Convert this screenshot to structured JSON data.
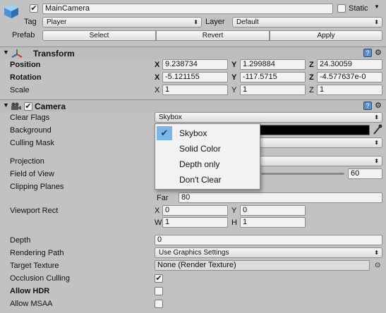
{
  "header": {
    "object_name": "MainCamera",
    "active_checked": true,
    "static_label": "Static",
    "tag_label": "Tag",
    "tag_value": "Player",
    "layer_label": "Layer",
    "layer_value": "Default",
    "prefab_label": "Prefab",
    "select_label": "Select",
    "revert_label": "Revert",
    "apply_label": "Apply"
  },
  "transform": {
    "title": "Transform",
    "position_label": "Position",
    "rotation_label": "Rotation",
    "scale_label": "Scale",
    "axis_x": "X",
    "axis_y": "Y",
    "axis_z": "Z",
    "position": {
      "x": "9.238734",
      "y": "1.299884",
      "z": "24.30059"
    },
    "rotation": {
      "x": "-5.121155",
      "y": "-117.5715",
      "z": "-4.577637e-0"
    },
    "scale": {
      "x": "1",
      "y": "1",
      "z": "1"
    }
  },
  "camera": {
    "title": "Camera",
    "enabled": true,
    "clear_flags_label": "Clear Flags",
    "clear_flags_value": "Skybox",
    "background_label": "Background",
    "background_color": "#000000",
    "culling_mask_label": "Culling Mask",
    "projection_label": "Projection",
    "fov_label": "Field of View",
    "fov_value": "60",
    "clipping_label": "Clipping Planes",
    "far_label": "Far",
    "far_value": "80",
    "viewport_label": "Viewport Rect",
    "viewport": {
      "x_label": "X",
      "y_label": "Y",
      "w_label": "W",
      "h_label": "H",
      "x": "0",
      "y": "0",
      "w": "1",
      "h": "1"
    },
    "depth_label": "Depth",
    "depth_value": "0",
    "rendering_path_label": "Rendering Path",
    "rendering_path_value": "Use Graphics Settings",
    "target_texture_label": "Target Texture",
    "target_texture_value": "None (Render Texture)",
    "occlusion_label": "Occlusion Culling",
    "occlusion_checked": true,
    "hdr_label": "Allow HDR",
    "hdr_checked": false,
    "msaa_label": "Allow MSAA",
    "msaa_checked": false
  },
  "clear_flags_menu": {
    "items": [
      "Skybox",
      "Solid Color",
      "Depth only",
      "Don't Clear"
    ],
    "selected_index": 0
  },
  "colors": {
    "panel_bg": "#c2c2c2",
    "selection_highlight": "#7fb4e6",
    "help_icon": "#5d8cc6"
  }
}
